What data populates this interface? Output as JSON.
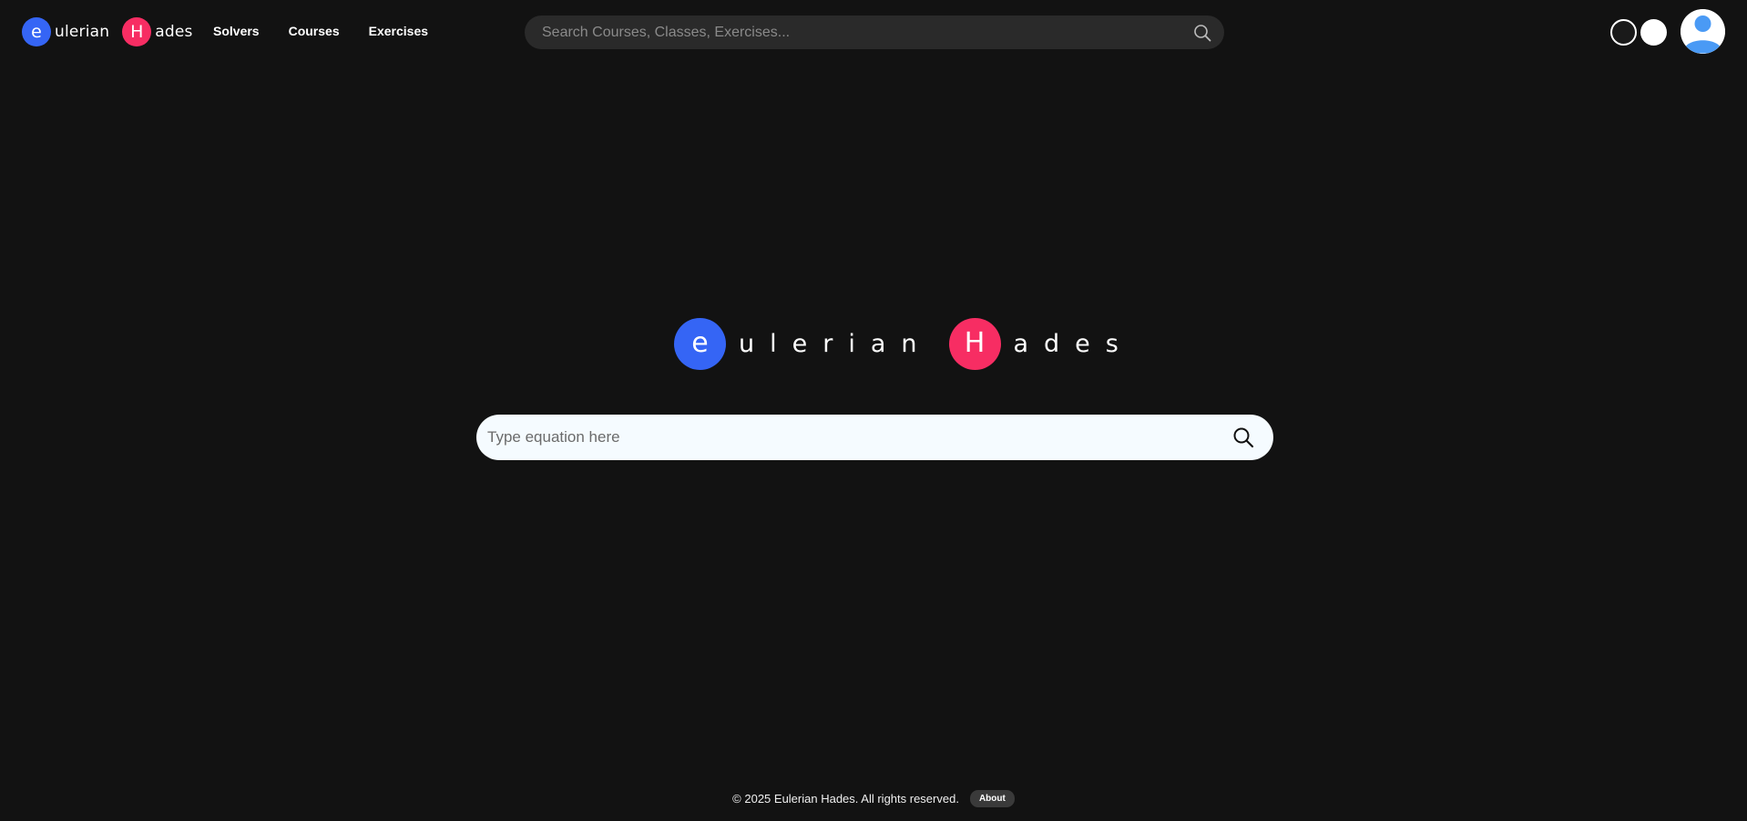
{
  "header": {
    "brand": {
      "first_letter": "e",
      "first_word": "ulerian",
      "second_letter": "H",
      "second_word": "ades"
    },
    "nav": [
      {
        "label": "Solvers"
      },
      {
        "label": "Courses"
      },
      {
        "label": "Exercises"
      }
    ],
    "search": {
      "placeholder": "Search Courses, Classes, Exercises...",
      "icon": "search-icon"
    },
    "theme_toggle": {
      "dark_icon": "dark-theme-circle",
      "light_icon": "light-theme-circle"
    },
    "avatar": {
      "icon": "user-avatar-icon"
    }
  },
  "hero": {
    "logo": {
      "first_letter": "e",
      "first_word": "ulerian",
      "second_letter": "H",
      "second_word": "ades"
    },
    "equation_input": {
      "placeholder": "Type equation here",
      "icon": "search-icon"
    }
  },
  "footer": {
    "copyright": "© 2025 Eulerian Hades. All rights reserved.",
    "about_label": "About"
  },
  "colors": {
    "background": "#121212",
    "brand_blue": "#3565f5",
    "brand_pink": "#f72d63",
    "top_search_bg": "#2a2a2a",
    "main_search_bg": "#f5fbff",
    "avatar_blue": "#4a9af5"
  }
}
